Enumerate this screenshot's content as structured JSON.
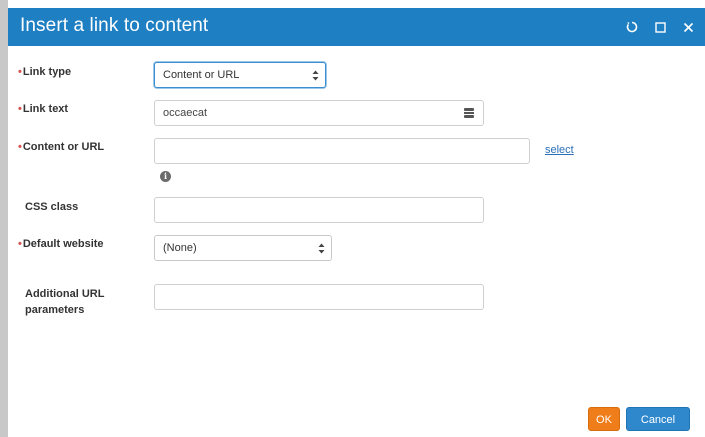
{
  "dialog": {
    "title": "Insert a link to content",
    "controls": [
      "restore-icon",
      "maximize-icon",
      "close-icon"
    ]
  },
  "fields": {
    "link_type": {
      "label": "Link type",
      "value": "Content or URL",
      "required": true
    },
    "link_text": {
      "label": "Link text",
      "value": "occaecat",
      "required": true,
      "icon": "macro-icon"
    },
    "content_or_url": {
      "label": "Content or URL",
      "value": "",
      "required": true,
      "select_link": "select",
      "info_icon": "i"
    },
    "css_class": {
      "label": "CSS class",
      "value": "",
      "required": false
    },
    "default_website": {
      "label": "Default website",
      "value": "(None)",
      "required": true
    },
    "additional_url_parameters": {
      "label_line1": "Additional URL",
      "label_line2": "parameters",
      "value": "",
      "required": false
    }
  },
  "buttons": {
    "ok": "OK",
    "cancel": "Cancel"
  },
  "colors": {
    "titlebar": "#1f7fc3",
    "ok": "#ef7d1a",
    "cancel": "#2f88cc",
    "required_marker": "#d9534f",
    "link": "#2a6fb8"
  }
}
